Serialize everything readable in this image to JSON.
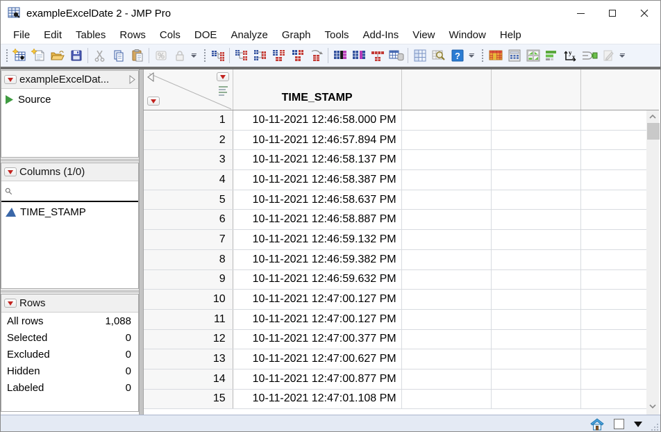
{
  "titlebar": {
    "title": "exampleExcelDate 2 - JMP Pro",
    "app_icon": "jmp-data-table-icon",
    "window_controls": [
      "minimize",
      "maximize",
      "close"
    ]
  },
  "menubar": {
    "items": [
      "File",
      "Edit",
      "Tables",
      "Rows",
      "Cols",
      "DOE",
      "Analyze",
      "Graph",
      "Tools",
      "Add-Ins",
      "View",
      "Window",
      "Help"
    ]
  },
  "toolbar": {
    "groups": [
      {
        "icons": [
          "new-data-table",
          "new-journal",
          "open",
          "save",
          "cut",
          "copy",
          "paste",
          "row-states",
          "lock",
          "overflow"
        ]
      },
      {
        "icons": [
          "hierarchy",
          "split",
          "stack",
          "join",
          "concatenate",
          "transpose",
          "update",
          "merge",
          "summary",
          "query-builder",
          "tabulate",
          "table-search",
          "help",
          "overflow"
        ]
      },
      {
        "icons": [
          "data-filter",
          "calculator-table",
          "four-pane",
          "graph-builder",
          "fit-y-by-x",
          "formula",
          "edit",
          "overflow"
        ]
      }
    ]
  },
  "sidebar": {
    "table_panel": {
      "title": "exampleExcelDat...",
      "items": [
        {
          "label": "Source",
          "icon": "green-play-icon"
        }
      ]
    },
    "columns_panel": {
      "title": "Columns (1/0)",
      "search_value": "",
      "items": [
        {
          "label": "TIME_STAMP",
          "icon": "continuous-icon"
        }
      ]
    },
    "rows_panel": {
      "title": "Rows",
      "stats": [
        {
          "label": "All rows",
          "value": "1,088"
        },
        {
          "label": "Selected",
          "value": "0"
        },
        {
          "label": "Excluded",
          "value": "0"
        },
        {
          "label": "Hidden",
          "value": "0"
        },
        {
          "label": "Labeled",
          "value": "0"
        }
      ]
    }
  },
  "table": {
    "header": {
      "column": "TIME_STAMP",
      "empty_columns": 3
    },
    "rows": [
      {
        "n": "1",
        "t": "10-11-2021 12:46:58.000 PM"
      },
      {
        "n": "2",
        "t": "10-11-2021 12:46:57.894 PM"
      },
      {
        "n": "3",
        "t": "10-11-2021 12:46:58.137 PM"
      },
      {
        "n": "4",
        "t": "10-11-2021 12:46:58.387 PM"
      },
      {
        "n": "5",
        "t": "10-11-2021 12:46:58.637 PM"
      },
      {
        "n": "6",
        "t": "10-11-2021 12:46:58.887 PM"
      },
      {
        "n": "7",
        "t": "10-11-2021 12:46:59.132 PM"
      },
      {
        "n": "8",
        "t": "10-11-2021 12:46:59.382 PM"
      },
      {
        "n": "9",
        "t": "10-11-2021 12:46:59.632 PM"
      },
      {
        "n": "10",
        "t": "10-11-2021 12:47:00.127 PM"
      },
      {
        "n": "11",
        "t": "10-11-2021 12:47:00.127 PM"
      },
      {
        "n": "12",
        "t": "10-11-2021 12:47:00.377 PM"
      },
      {
        "n": "13",
        "t": "10-11-2021 12:47:00.627 PM"
      },
      {
        "n": "14",
        "t": "10-11-2021 12:47:00.877 PM"
      },
      {
        "n": "15",
        "t": "10-11-2021 12:47:01.108 PM"
      }
    ]
  },
  "statusbar": {
    "icons": [
      "home",
      "white-box",
      "dropdown-arrow",
      "resize-grip"
    ]
  },
  "colors": {
    "accent_red": "#c2231f",
    "continuous_blue": "#3a67a8",
    "source_green": "#3f9b41",
    "toolbar_bg": "#f0f4fb",
    "status_bg": "#e4eaf4"
  }
}
